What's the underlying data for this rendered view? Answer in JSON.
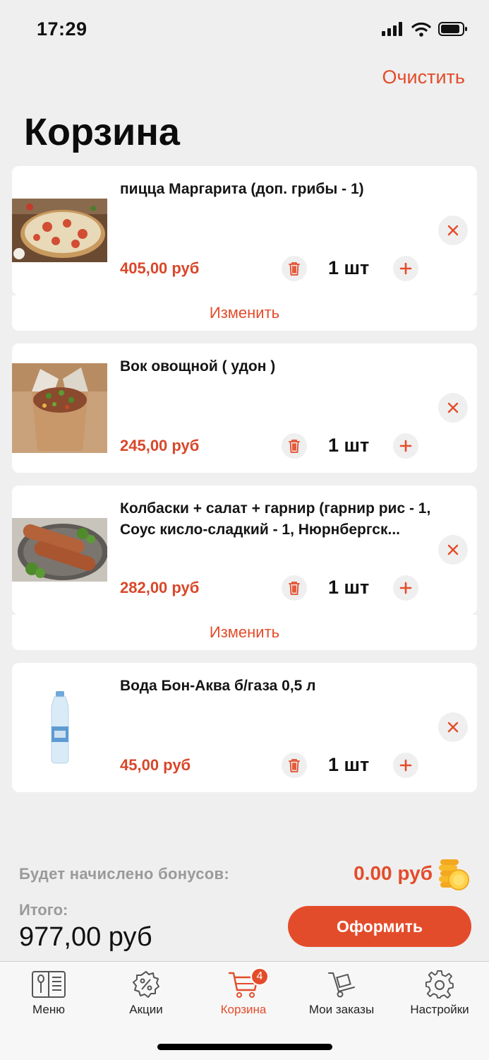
{
  "status": {
    "time": "17:29"
  },
  "header": {
    "clear_label": "Очистить",
    "title": "Корзина"
  },
  "cart": {
    "items": [
      {
        "name": "пицца Маргарита (доп. грибы  - 1)",
        "price": "405,00 руб",
        "qty": "1 шт",
        "image": "pizza-image",
        "has_change": true
      },
      {
        "name": "Вок овощной  ( удон )",
        "price": "245,00 руб",
        "qty": "1 шт",
        "image": "wok-image",
        "has_change": false
      },
      {
        "name": "Колбаски + салат + гарнир (гарнир рис - 1, Соус кисло-сладкий - 1, Нюрнбергск...",
        "price": "282,00 руб",
        "qty": "1 шт",
        "image": "sausages-image",
        "has_change": true
      },
      {
        "name": "Вода Бон-Аква б/газа  0,5 л",
        "price": "45,00 руб",
        "qty": "1 шт",
        "image": "water-bottle-image",
        "has_change": false
      }
    ],
    "change_label": "Изменить"
  },
  "summary": {
    "bonus_label": "Будет начислено бонусов:",
    "bonus_value": "0.00 руб",
    "total_label": "Итого:",
    "total_value": "977,00 руб",
    "checkout_label": "Оформить"
  },
  "tabs": [
    {
      "label": "Меню",
      "icon": "menu-book-icon"
    },
    {
      "label": "Акции",
      "icon": "discount-gear-icon"
    },
    {
      "label": "Корзина",
      "icon": "cart-icon",
      "active": true,
      "badge": "4"
    },
    {
      "label": "Мои заказы",
      "icon": "hand-truck-icon"
    },
    {
      "label": "Настройки",
      "icon": "settings-gear-icon"
    }
  ],
  "colors": {
    "accent": "#e34c2b",
    "background": "#efefef",
    "card": "#ffffff",
    "muted": "#9a9a9a"
  }
}
